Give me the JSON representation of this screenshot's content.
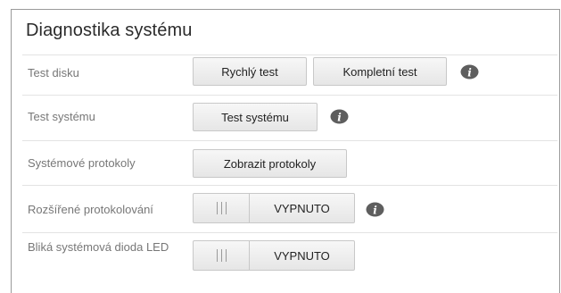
{
  "panel": {
    "title": "Diagnostika systému"
  },
  "rows": {
    "disk_test": {
      "label": "Test disku",
      "quick_button": "Rychlý test",
      "full_button": "Kompletní test"
    },
    "system_test": {
      "label": "Test systému",
      "button": "Test systému"
    },
    "system_logs": {
      "label": "Systémové protokoly",
      "button": "Zobrazit protokoly"
    },
    "extended_logging": {
      "label": "Rozšířené protokolování",
      "state": "VYPNUTO"
    },
    "led_blink": {
      "label": "Bliká systémová dioda LED",
      "state": "VYPNUTO"
    }
  },
  "colors": {
    "info_icon": "#5e5e5e",
    "label_text": "#777777",
    "button_bg": "#eeeeee"
  },
  "icons": {
    "info": "info-icon",
    "toggle_grip": "grip-icon"
  }
}
